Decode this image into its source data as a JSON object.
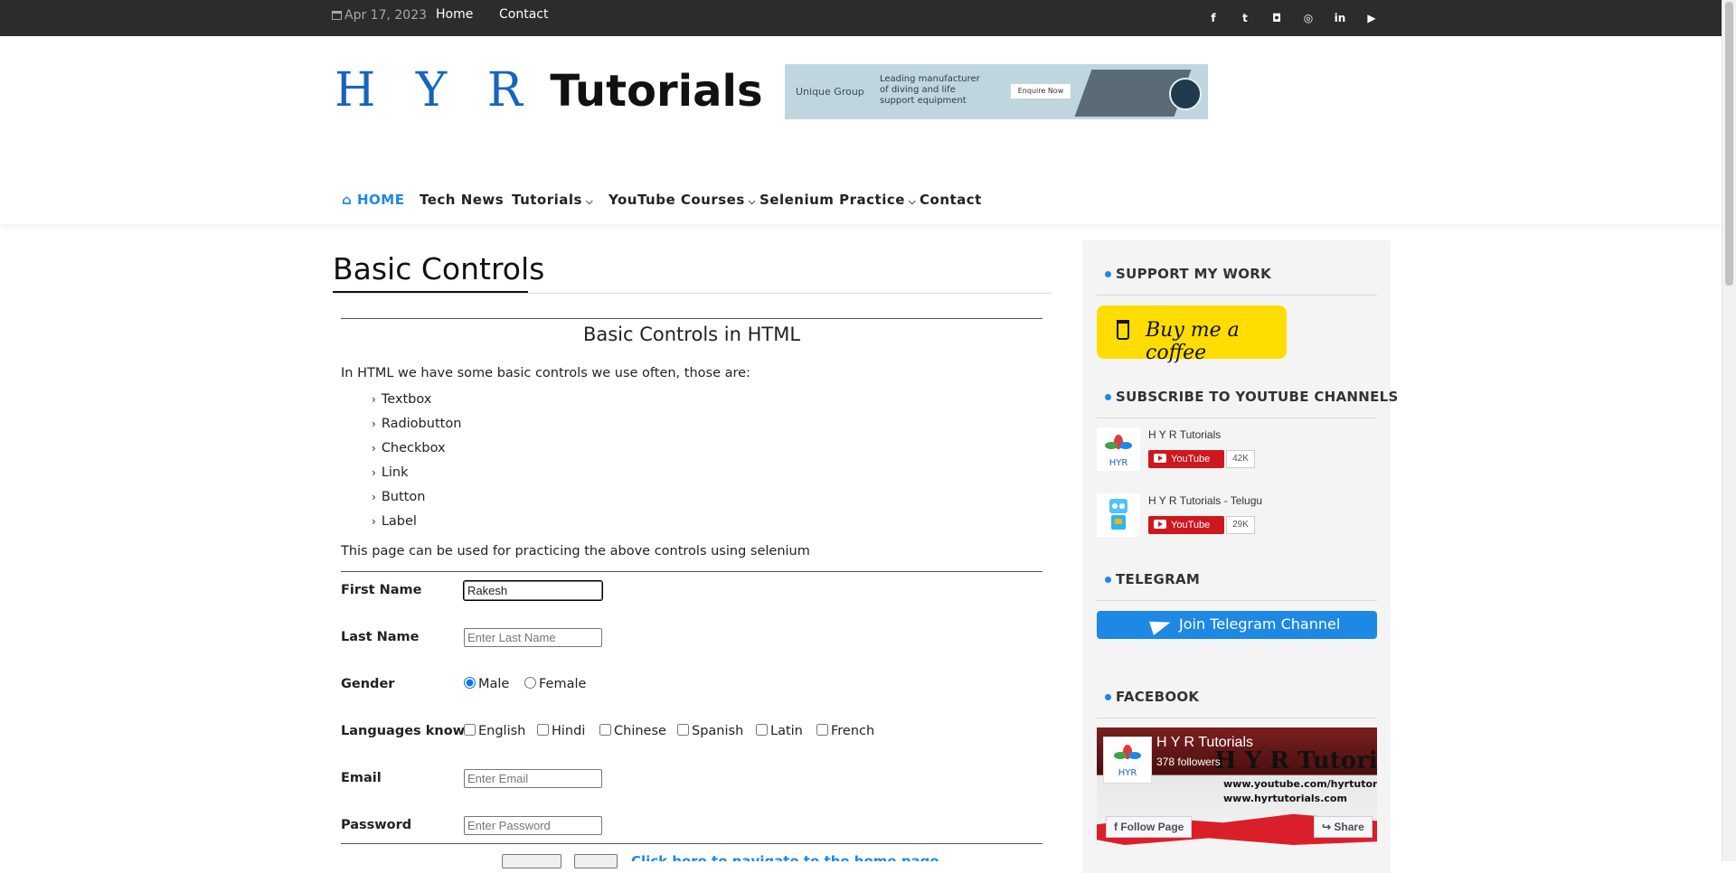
{
  "topbar": {
    "date": "Apr 17, 2023",
    "links": [
      "Home",
      "Contact"
    ],
    "social_icons": [
      "facebook-icon",
      "twitter-icon",
      "snapchat-icon",
      "instagram-icon",
      "linkedin-icon",
      "youtube-icon"
    ]
  },
  "header": {
    "logo_part1": "H Y R",
    "logo_part2": "Tutorials",
    "ad": {
      "brand": "Unique Group",
      "text": "Leading manufacturer of diving and life support equipment",
      "button": "Enquire Now"
    }
  },
  "nav": {
    "home": "HOME",
    "items": [
      "Tech News",
      "Tutorials",
      "YouTube Courses",
      "Selenium Practice",
      "Contact"
    ]
  },
  "main": {
    "title": "Basic Controls",
    "heading": "Basic Controls in HTML",
    "intro": "In HTML we have some basic controls we use often, those are:",
    "controls": [
      "Textbox",
      "Radiobutton",
      "Checkbox",
      "Link",
      "Button",
      "Label"
    ],
    "note": "This page can be used for practicing the above controls using selenium"
  },
  "form": {
    "first_name_label": "First Name",
    "first_name_value": "Rakesh",
    "last_name_label": "Last Name",
    "last_name_placeholder": "Enter Last Name",
    "gender_label": "Gender",
    "gender_options": [
      "Male",
      "Female"
    ],
    "gender_selected": "Male",
    "languages_label": "Languages known",
    "languages": [
      "English",
      "Hindi",
      "Chinese",
      "Spanish",
      "Latin",
      "French"
    ],
    "email_label": "Email",
    "email_placeholder": "Enter Email",
    "password_label": "Password",
    "password_placeholder": "Enter Password",
    "partial_link": "Click here to navigate to the home page"
  },
  "sidebar": {
    "support_heading": "SUPPORT MY WORK",
    "coffee_label": "Buy me a coffee",
    "subscribe_heading": "SUBSCRIBE TO YOUTUBE CHANNELS",
    "channels": [
      {
        "name": "H Y R Tutorials",
        "button": "YouTube",
        "count": "42K"
      },
      {
        "name": "H Y R Tutorials - Telugu",
        "button": "YouTube",
        "count": "29K"
      }
    ],
    "telegram_heading": "TELEGRAM",
    "telegram_button": "Join Telegram Channel",
    "facebook_heading": "FACEBOOK",
    "facebook": {
      "page_name": "H Y R Tutorials",
      "followers": "378 followers",
      "banner_text": "H Y R Tutorials",
      "url1": "www.youtube.com/hyrtutorials",
      "url2": "www.hyrtutorials.com",
      "follow_button": "Follow Page",
      "share_button": "Share"
    }
  },
  "colors": {
    "accent": "#1e88e5",
    "topbar_bg": "#2c2c2c",
    "coffee_yellow": "#ffdd00",
    "youtube_red": "#cc181e"
  }
}
